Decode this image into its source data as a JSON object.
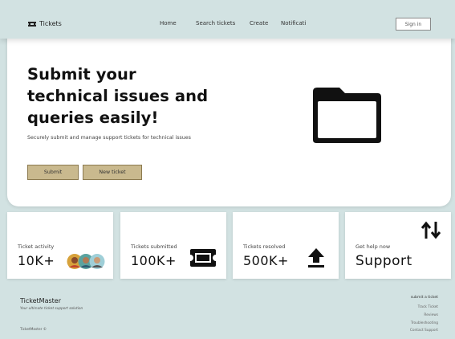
{
  "nav": {
    "brand": "Tickets",
    "links": [
      "Home",
      "Search tickets",
      "Create",
      "Notificati"
    ],
    "signin": "Sign in"
  },
  "hero": {
    "title": "Submit your technical issues and queries easily!",
    "subtitle": "Securely submit and manage support tickets for technical issues",
    "submit_label": "Submit",
    "new_ticket_label": "New ticket"
  },
  "stats": [
    {
      "label": "Ticket activity",
      "value": "10K+"
    },
    {
      "label": "Tickets submitted",
      "value": "100K+"
    },
    {
      "label": "Tickets resolved",
      "value": "500K+"
    },
    {
      "label": "Get help now",
      "value": "Support"
    }
  ],
  "footer": {
    "brand": "TicketMaster",
    "tagline": "Your ultimate ticket support solution",
    "copyright": "TicketMaster ©",
    "links_heading": "submit a ticket",
    "links": [
      "Track Ticket",
      "Reviews",
      "Troubleshooting",
      "Contact Support"
    ]
  },
  "colors": {
    "background": "#d2e2e2",
    "button": "#c9b98e",
    "card": "#ffffff"
  },
  "icons": [
    "ticket-logo-icon",
    "folder-icon",
    "avatar-group",
    "ticket-icon",
    "upload-icon",
    "swap-vertical-icon"
  ]
}
